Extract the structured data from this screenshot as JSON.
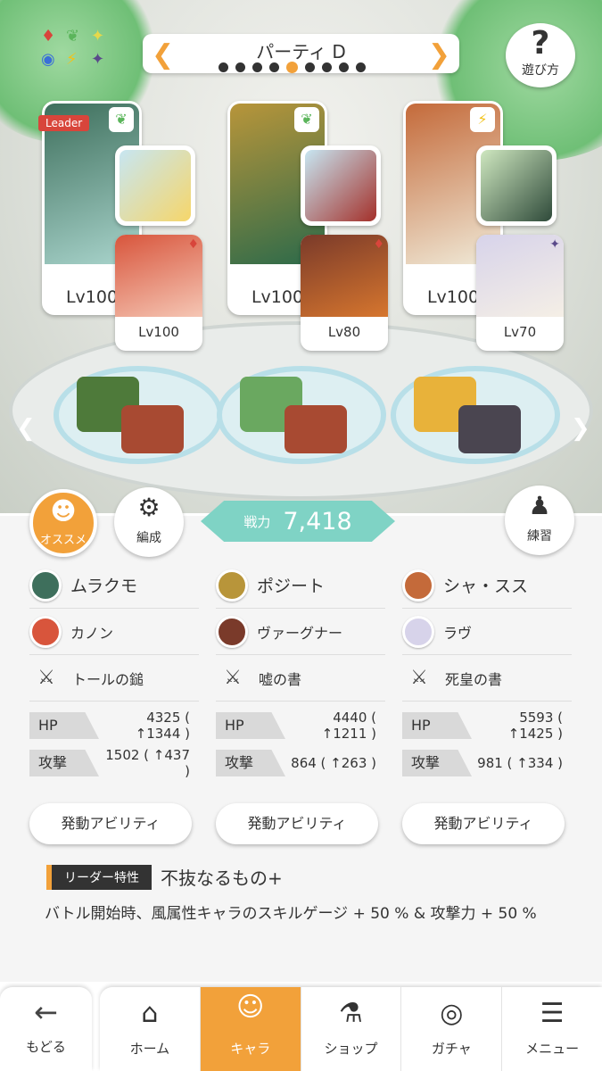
{
  "header": {
    "party_title": "パーティ D",
    "page_count": 9,
    "active_page_index": 4,
    "help_label": "遊び方"
  },
  "members": [
    {
      "name": "ムラクモ",
      "level": "Lv100",
      "leader_tag": "Leader",
      "type_icon": "leaf-icon",
      "equipment_name": "トールの鎚",
      "sub_name": "カノン",
      "sub_level": "Lv100",
      "sub_element": "fire-icon",
      "hp_label": "HP",
      "hp_value": "4325 ( ↑1344 )",
      "atk_label": "攻撃",
      "atk_value": "1502 ( ↑437 )",
      "ability_label": "発動アビリティ",
      "colors": {
        "portrait": "#3e6f5c",
        "equip": "#c7e6f2",
        "sub": "#d8553c",
        "base_a": "#4e7a3a",
        "base_b": "#a84a32"
      }
    },
    {
      "name": "ポジート",
      "level": "Lv100",
      "leader_tag": "",
      "type_icon": "leaf-icon",
      "equipment_name": "嘘の書",
      "sub_name": "ヴァーグナー",
      "sub_level": "Lv80",
      "sub_element": "fire-icon",
      "hp_label": "HP",
      "hp_value": "4440 ( ↑1211 )",
      "atk_label": "攻撃",
      "atk_value": "864 ( ↑263 )",
      "ability_label": "発動アビリティ",
      "colors": {
        "portrait": "#b8953a",
        "equip": "#c7e6f2",
        "sub": "#7a3a2a",
        "base_a": "#6aa860",
        "base_b": "#a84a32"
      }
    },
    {
      "name": "シャ・スス",
      "level": "Lv100",
      "leader_tag": "",
      "type_icon": "bolt-icon",
      "equipment_name": "死皇の書",
      "sub_name": "ラヴ",
      "sub_level": "Lv70",
      "sub_element": "dark-icon",
      "hp_label": "HP",
      "hp_value": "5593 ( ↑1425 )",
      "atk_label": "攻撃",
      "atk_value": "981 ( ↑334 )",
      "ability_label": "発動アビリティ",
      "colors": {
        "portrait": "#c46a3a",
        "equip": "#cfe8c0",
        "sub": "#d7d3ea",
        "base_a": "#e8b23a",
        "base_b": "#4a4550"
      }
    }
  ],
  "actions": {
    "recommend_label": "オススメ",
    "formation_label": "編成",
    "training_label": "練習"
  },
  "power": {
    "label": "戦力",
    "value": "7,418"
  },
  "leader_skill": {
    "label": "リーダー特性",
    "name": "不抜なるもの+",
    "description": "バトル開始時、風属性キャラのスキルゲージ + 50 % & 攻撃力 + 50 %"
  },
  "nav": {
    "back_label": "もどる",
    "tabs": [
      {
        "label": "ホーム",
        "icon": "home-icon",
        "active": false
      },
      {
        "label": "キャラ",
        "icon": "character-icon",
        "active": true
      },
      {
        "label": "ショップ",
        "icon": "shop-icon",
        "active": false
      },
      {
        "label": "ガチャ",
        "icon": "gacha-icon",
        "active": false
      },
      {
        "label": "メニュー",
        "icon": "menu-icon",
        "active": false
      }
    ]
  },
  "colors": {
    "accent": "#f2a13a",
    "power_bg": "#7fd3c5",
    "leader_red": "#d8453b"
  }
}
